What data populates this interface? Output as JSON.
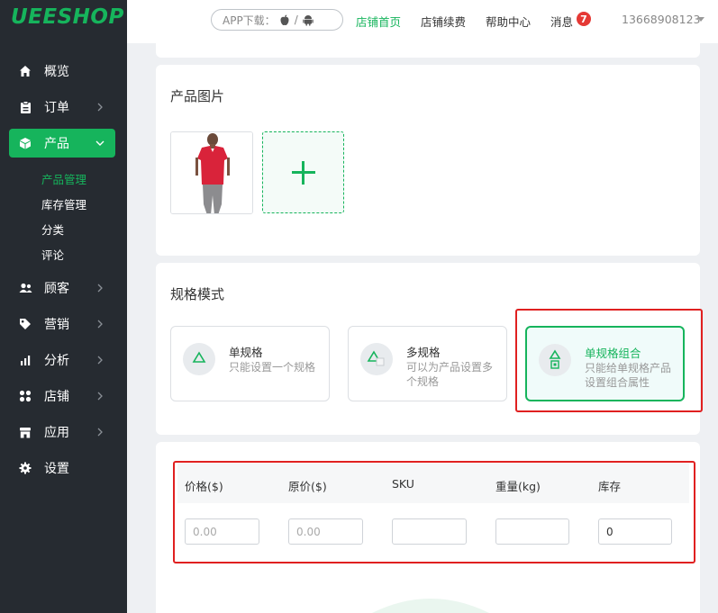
{
  "brand": {
    "logo": "UEESHOP",
    "accent": "#16b45c",
    "sidebar_bg": "#262b31"
  },
  "sidebar": {
    "items": [
      {
        "label": "概览",
        "icon": "home-icon"
      },
      {
        "label": "订单",
        "icon": "clipboard-icon"
      },
      {
        "label": "产品",
        "icon": "cube-icon",
        "active": true
      },
      {
        "label": "顾客",
        "icon": "users-icon"
      },
      {
        "label": "营销",
        "icon": "tag-icon"
      },
      {
        "label": "分析",
        "icon": "bar-chart-icon"
      },
      {
        "label": "店铺",
        "icon": "grid-icon"
      },
      {
        "label": "应用",
        "icon": "store-icon"
      },
      {
        "label": "设置",
        "icon": "gear-icon"
      }
    ],
    "product_sub": [
      "产品管理",
      "库存管理",
      "分类",
      "评论"
    ]
  },
  "topbar": {
    "app_download": "APP下载：",
    "app_sep": "/",
    "links": [
      "店铺首页",
      "店铺续费",
      "帮助中心",
      "消息"
    ],
    "message_count": "7",
    "phone": "13668908123"
  },
  "images_card": {
    "title": "产品图片"
  },
  "spec_card": {
    "title": "规格模式",
    "options": [
      {
        "title": "单规格",
        "desc": "只能设置一个规格"
      },
      {
        "title": "多规格",
        "desc": "可以为产品设置多个规格"
      },
      {
        "title": "单规格组合",
        "desc": "只能给单规格产品设置组合属性",
        "selected": true
      }
    ]
  },
  "price_table": {
    "headers": [
      "价格($)",
      "原价($)",
      "SKU",
      "重量(kg)",
      "库存"
    ],
    "placeholders": [
      "0.00",
      "0.00",
      "",
      "",
      ""
    ],
    "values": [
      "",
      "",
      "",
      "",
      "0"
    ]
  }
}
